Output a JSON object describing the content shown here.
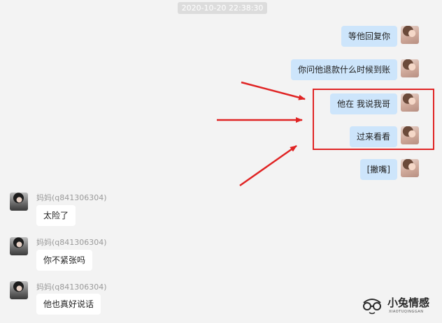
{
  "timestamp": "2020-10-20 22:38:30",
  "messages_self": [
    {
      "text": "等他回复你"
    },
    {
      "text": "你问他退款什么时候到账"
    },
    {
      "text": "他在 我说我哥"
    },
    {
      "text": "过来看看"
    },
    {
      "text": "[撇嘴]"
    }
  ],
  "messages_mom": [
    {
      "sender": "妈妈(q841306304)",
      "text": "太险了"
    },
    {
      "sender": "妈妈(q841306304)",
      "text": "你不紧张吗"
    },
    {
      "sender": "妈妈(q841306304)",
      "text": "他也真好说话"
    }
  ],
  "annotation": {
    "color": "#e02424"
  },
  "watermark": {
    "title": "小兔情感",
    "subtitle": "XIAOTUQINGGAN"
  }
}
